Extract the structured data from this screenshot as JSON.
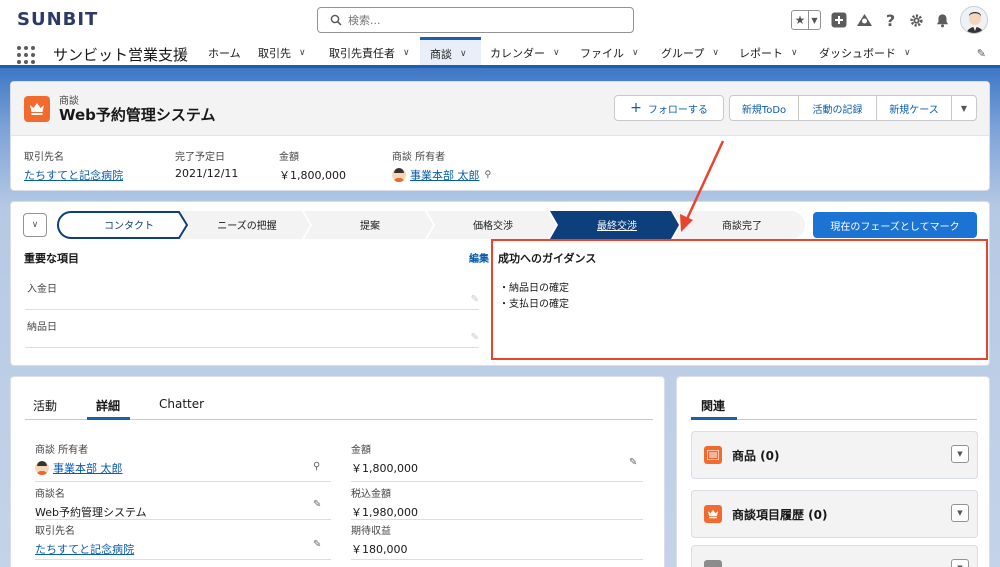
{
  "header": {
    "logo": "SUNBIT",
    "search": {
      "placeholder": "検索..."
    }
  },
  "nav": {
    "app_name": "サンビット営業支援",
    "items": [
      {
        "label": "ホーム",
        "has_menu": false
      },
      {
        "label": "取引先",
        "has_menu": true
      },
      {
        "label": "取引先責任者",
        "has_menu": true
      },
      {
        "label": "商談",
        "has_menu": true,
        "active": true
      },
      {
        "label": "カレンダー",
        "has_menu": true
      },
      {
        "label": "ファイル",
        "has_menu": true
      },
      {
        "label": "グループ",
        "has_menu": true
      },
      {
        "label": "レポート",
        "has_menu": true
      },
      {
        "label": "ダッシュボード",
        "has_menu": true
      }
    ]
  },
  "record": {
    "object_label": "商談",
    "title": "Web予約管理システム",
    "buttons": {
      "follow": "フォローする",
      "new_todo": "新規ToDo",
      "log_activity": "活動の記録",
      "new_case": "新規ケース"
    },
    "highlights": [
      {
        "label": "取引先名",
        "value": "たちすてと記念病院",
        "link": true
      },
      {
        "label": "完了予定日",
        "value": "2021/12/11",
        "link": false
      },
      {
        "label": "金額",
        "value": "￥1,800,000",
        "link": false
      },
      {
        "label": "商談 所有者",
        "value": "事業本部 太郎",
        "link": true,
        "owner": true
      }
    ]
  },
  "path": {
    "stages": [
      {
        "label": "コンタクト",
        "state": "completed-current-outline"
      },
      {
        "label": "ニーズの把握",
        "state": "incomplete"
      },
      {
        "label": "提案",
        "state": "incomplete"
      },
      {
        "label": "価格交渉",
        "state": "incomplete"
      },
      {
        "label": "最終交渉",
        "state": "selected"
      },
      {
        "label": "商談完了",
        "state": "incomplete"
      }
    ],
    "mark_button": "現在のフェーズとしてマーク",
    "key_fields_title": "重要な項目",
    "edit_label": "編集",
    "key_fields": [
      {
        "label": "入金日"
      },
      {
        "label": "納品日"
      }
    ],
    "guidance_title": "成功へのガイダンス",
    "guidance_items": [
      "・納品日の確定",
      "・支払日の確定"
    ]
  },
  "detail": {
    "tabs": [
      "活動",
      "詳細",
      "Chatter"
    ],
    "active_tab": "詳細",
    "fields_left": [
      {
        "label": "商談 所有者",
        "value": "事業本部 太郎",
        "link": true,
        "owner": true
      },
      {
        "label": "商談名",
        "value": "Web予約管理システム",
        "link": false
      },
      {
        "label": "取引先名",
        "value": "たちすてと記念病院",
        "link": true
      }
    ],
    "fields_right": [
      {
        "label": "金額",
        "value": "￥1,800,000"
      },
      {
        "label": "税込金額",
        "value": "￥1,980,000"
      },
      {
        "label": "期待収益",
        "value": "￥180,000"
      }
    ]
  },
  "related": {
    "tab": "関連",
    "lists": [
      {
        "title": "商品 (0)",
        "color": "#f26a2e",
        "icon": "product-icon"
      },
      {
        "title": "商談項目履歴 (0)",
        "color": "#f26a2e",
        "icon": "crown-icon"
      },
      {
        "title": "",
        "color": "#8c8c8c",
        "icon": "file-icon"
      }
    ]
  },
  "colors": {
    "brand_blue": "#1b5fb0",
    "path_selected": "#0d3f7d",
    "accent_orange": "#f26a2e",
    "annotation_red": "#e8442e"
  }
}
